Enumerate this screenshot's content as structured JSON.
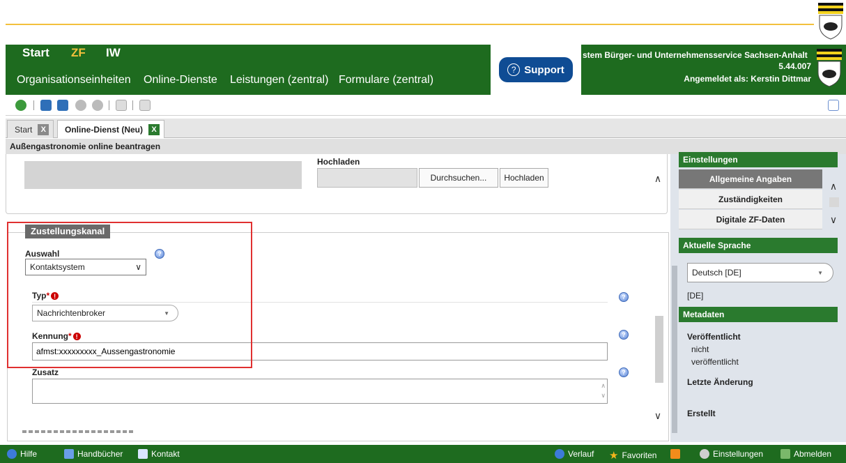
{
  "header": {
    "modules": [
      "Start",
      "ZF",
      "IW"
    ],
    "nav": [
      "Organisationseinheiten",
      "Online-Dienste",
      "Leistungen (zentral)",
      "Formulare (zentral)"
    ],
    "support_label": "Support",
    "system_title": "stem Bürger- und Unternehmensservice Sachsen-Anhalt",
    "version": "5.44.007",
    "logged_in": "Angemeldet als: Kerstin Dittmar"
  },
  "tabs": [
    {
      "label": "Start",
      "close": "X"
    },
    {
      "label": "Online-Dienst (Neu)",
      "close": "X"
    }
  ],
  "page_title": "Außengastronomie online beantragen",
  "upload": {
    "label": "Hochladen",
    "browse_button": "Durchsuchen...",
    "upload_button": "Hochladen"
  },
  "form": {
    "legend": "Zustellungskanal",
    "auswahl_label": "Auswahl",
    "auswahl_value": "Kontaktsystem",
    "typ_label": "Typ",
    "typ_value": "Nachrichtenbroker",
    "kennung_label": "Kennung",
    "kennung_value": "afmst:xxxxxxxxx_Aussengastronomie",
    "zusatz_label": "Zusatz",
    "required_mark": "*"
  },
  "right_panel": {
    "settings_header": "Einstellungen",
    "settings_items": [
      "Allgemeine Angaben",
      "Zuständigkeiten",
      "Digitale ZF-Daten"
    ],
    "language_header": "Aktuelle Sprache",
    "language_value": "Deutsch [DE]",
    "language_code": "[DE]",
    "metadata_header": "Metadaten",
    "published_label": "Veröffentlicht",
    "published_value_1": "nicht",
    "published_value_2": "veröffentlicht",
    "last_change_label": "Letzte Änderung",
    "created_label": "Erstellt"
  },
  "footer": {
    "left": [
      "Hilfe",
      "Handbücher",
      "Kontakt"
    ],
    "right": [
      "Verlauf",
      "Favoriten",
      "Einstellungen",
      "Abmelden"
    ]
  },
  "colors": {
    "header_green": "#1e6b1f",
    "zf_accent": "#f3c03c",
    "support_blue": "#0f4c94",
    "highlight_red": "#e03030"
  }
}
